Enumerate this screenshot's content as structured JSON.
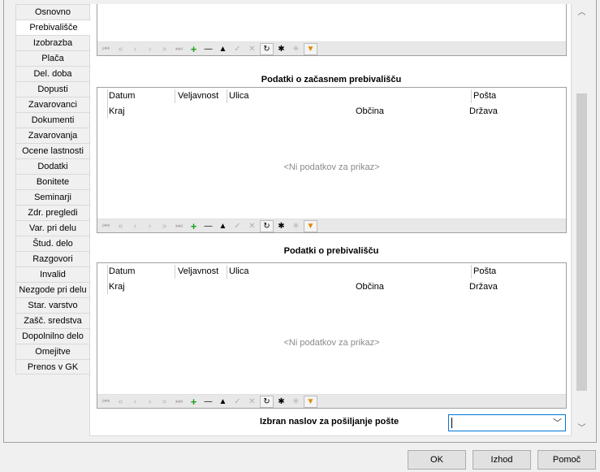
{
  "tabs": [
    "Osnovno",
    "Prebivališče",
    "Izobrazba",
    "Plača",
    "Del. doba",
    "Dopusti",
    "Zavarovanci",
    "Dokumenti",
    "Zavarovanja",
    "Ocene lastnosti",
    "Dodatki",
    "Bonitete",
    "Seminarji",
    "Zdr. pregledi",
    "Var. pri delu",
    "Štud. delo",
    "Razgovori",
    "Invalid",
    "Nezgode pri delu",
    "Star. varstvo",
    "Zašč. sredstva",
    "Dopolnilno delo",
    "Omejitve",
    "Prenos v GK"
  ],
  "active_tab": "Prebivališče",
  "sections": {
    "temporary": {
      "title": "Podatki o začasnem prebivališču",
      "columns_row1": [
        "Datum",
        "Veljavnost",
        "Ulica",
        "Pošta"
      ],
      "columns_row2": [
        "Kraj",
        "Občina",
        "Država"
      ],
      "empty_text": "<Ni podatkov za prikaz>"
    },
    "permanent": {
      "title": "Podatki o prebivališču",
      "columns_row1": [
        "Datum",
        "Veljavnost",
        "Ulica",
        "Pošta"
      ],
      "columns_row2": [
        "Kraj",
        "Občina",
        "Država"
      ],
      "empty_text": "<Ni podatkov za prikaz>"
    }
  },
  "navigator_icons": [
    "first-icon",
    "prev-page-icon",
    "prev-icon",
    "next-icon",
    "next-page-icon",
    "last-icon",
    "add-icon",
    "delete-icon",
    "edit-icon",
    "post-icon",
    "cancel-icon",
    "refresh-icon",
    "select-all-icon",
    "clear-icon",
    "filter-icon"
  ],
  "address_label": "Izbran naslov za pošiljanje pošte",
  "address_value": "",
  "buttons": {
    "ok": "OK",
    "exit": "Izhod",
    "help": "Pomoč"
  }
}
